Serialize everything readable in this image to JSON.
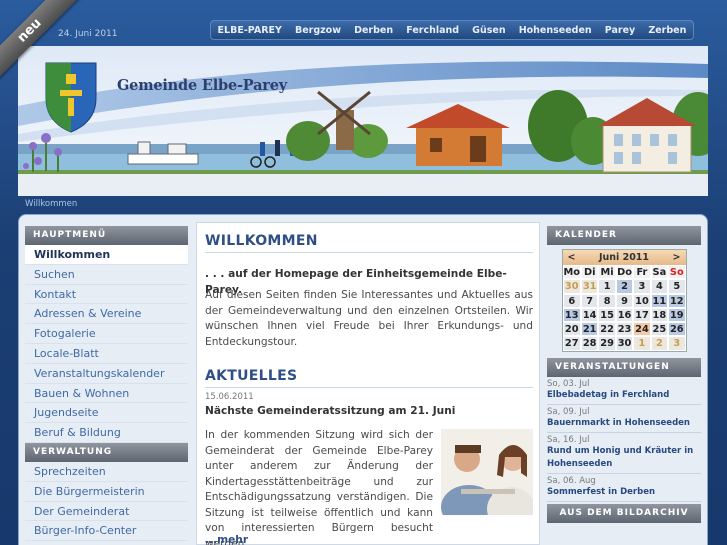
{
  "ribbon": "neu",
  "date": "24. Juni 2011",
  "topnav": [
    "ELBE-PAREY",
    "Bergzow",
    "Derben",
    "Ferchland",
    "Güsen",
    "Hohenseeden",
    "Parey",
    "Zerben"
  ],
  "site_title": "Gemeinde Elbe-Parey",
  "breadcrumb": "Willkommen",
  "menu": {
    "head1": "HAUPTMENÜ",
    "items1": [
      "Willkommen",
      "Suchen",
      "Kontakt",
      "Adressen & Vereine",
      "Fotogalerie",
      "Locale-Blatt",
      "Veranstaltungskalender",
      "Bauen & Wohnen",
      "Jugendseite",
      "Beruf & Bildung"
    ],
    "head2": "VERWALTUNG",
    "items2": [
      "Sprechzeiten",
      "Die Bürgermeisterin",
      "Der Gemeinderat",
      "Bürger-Info-Center"
    ]
  },
  "main": {
    "h1": "WILLKOMMEN",
    "intro": ". . . auf der Homepage der Einheitsgemeinde Elbe-Parey.",
    "text": "Auf diesen Seiten finden Sie Interessantes und Aktuelles aus der Gemeindeverwaltung und den einzelnen Ortsteilen. Wir wünschen Ihnen viel Freude bei Ihrer Erkundungs- und Entdeckungstour.",
    "h2": "AKTUELLES",
    "news_date": "15.06.2011",
    "news_title": "Nächste Gemeinderatssitzung am 21. Juni",
    "news_text": "In der kommenden Sitzung wird sich der Gemeinderat der Gemeinde Elbe-Parey unter anderem zur Änderung der Kindertagesstättenbeiträge und zur Entschädigungssatzung verständigen. Die Sitzung ist teilweise öffentlich und kann von interessierten Bürgern besucht werden.",
    "more": "...mehr"
  },
  "calendar": {
    "head": "KALENDER",
    "month": "Juni 2011",
    "prev": "<",
    "next": ">",
    "dow": [
      "Mo",
      "Di",
      "Mi",
      "Do",
      "Fr",
      "Sa",
      "So"
    ],
    "weeks": [
      [
        "30",
        "31",
        "1",
        "2",
        "3",
        "4",
        "5"
      ],
      [
        "6",
        "7",
        "8",
        "9",
        "10",
        "11",
        "12"
      ],
      [
        "13",
        "14",
        "15",
        "16",
        "17",
        "18",
        "19"
      ],
      [
        "20",
        "21",
        "22",
        "23",
        "24",
        "25",
        "26"
      ],
      [
        "27",
        "28",
        "29",
        "30",
        "1",
        "2",
        "3"
      ]
    ]
  },
  "events": {
    "head": "VERANSTALTUNGEN",
    "items": [
      {
        "date": "So, 03. Jul",
        "title": "Elbebadetag in Ferchland"
      },
      {
        "date": "Sa, 09. Jul",
        "title": "Bauernmarkt in Hohenseeden"
      },
      {
        "date": "Sa, 16. Jul",
        "title": "Rund um Honig und Kräuter in Hohenseeden"
      },
      {
        "date": "Sa, 06. Aug",
        "title": "Sommerfest in Derben"
      }
    ]
  },
  "archive_head": "AUS DEM BILDARCHIV"
}
